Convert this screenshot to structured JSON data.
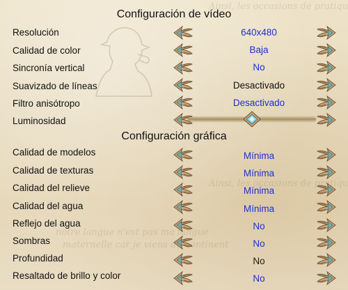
{
  "sections": {
    "video_title": "Configuración de vídeo",
    "graphics_title": "Configuración gráfica"
  },
  "video_rows": [
    {
      "label": "Resolución",
      "value": "640x480"
    },
    {
      "label": "Calidad de color",
      "value": "Baja"
    },
    {
      "label": "Sincronía vertical",
      "value": "No"
    },
    {
      "label": "Suavizado de líneas",
      "value": "Desactivado"
    },
    {
      "label": "Filtro anisótropo",
      "value": "Desactivado"
    },
    {
      "label": "Luminosidad",
      "value": null,
      "slider_position": 0.5
    }
  ],
  "graphics_rows": [
    {
      "label": "Calidad de modelos",
      "value": "Mínima"
    },
    {
      "label": "Calidad de texturas",
      "value": "Mínima"
    },
    {
      "label": "Calidad del relieve",
      "value": "Mínima"
    },
    {
      "label": "Calidad del agua",
      "value": "Mínima"
    },
    {
      "label": "Reflejo del agua",
      "value": "No"
    },
    {
      "label": "Sombras",
      "value": "No"
    },
    {
      "label": "Profundidad",
      "value": "No"
    },
    {
      "label": "Resaltado de brillo y color",
      "value": "No"
    }
  ],
  "colors": {
    "value_blue": "#1f2fd0",
    "value_black": "#111111",
    "arrow_gold": "#b8956a",
    "arrow_teal": "#5aa0a6"
  },
  "icons": {
    "left_arrow": "ornate-left-arrow-icon",
    "right_arrow": "ornate-right-arrow-icon",
    "slider_knob": "gem-slider-knob-icon",
    "background_figure": "sherlock-silhouette-icon"
  }
}
